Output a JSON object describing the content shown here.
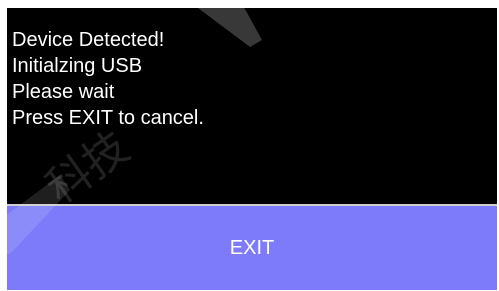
{
  "dialog": {
    "lines": [
      "Device Detected!",
      "Initialzing USB",
      "Please wait",
      "Press EXIT to cancel."
    ],
    "exit_label": "EXIT"
  },
  "watermark": {
    "text": "科技"
  },
  "colors": {
    "screen_background": "#000000",
    "text": "#ffffff",
    "button_background": "#7d7bfa",
    "divider": "#cfcfcf"
  }
}
